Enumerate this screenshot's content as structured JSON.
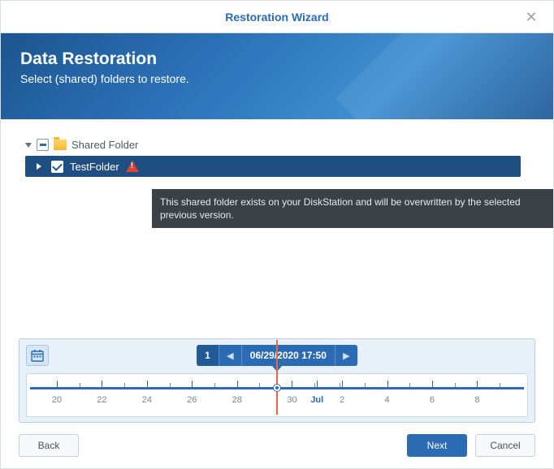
{
  "titlebar": {
    "title": "Restoration Wizard"
  },
  "banner": {
    "title": "Data Restoration",
    "subtitle": "Select (shared) folders to restore."
  },
  "tree": {
    "root_label": "Shared Folder",
    "child_label": "TestFolder"
  },
  "tooltip": {
    "text": "This shared folder exists on your DiskStation and will be overwritten by the selected previous version."
  },
  "timeline": {
    "version_index": "1",
    "current_label": "06/29/2020 17:50",
    "ticks": [
      {
        "label": "20",
        "pct": 6
      },
      {
        "label": "22",
        "pct": 15
      },
      {
        "label": "24",
        "pct": 24
      },
      {
        "label": "26",
        "pct": 33
      },
      {
        "label": "28",
        "pct": 42
      },
      {
        "label": "30",
        "pct": 53
      },
      {
        "label": "Jul",
        "pct": 58,
        "month": true
      },
      {
        "label": "2",
        "pct": 63
      },
      {
        "label": "4",
        "pct": 72
      },
      {
        "label": "6",
        "pct": 81
      },
      {
        "label": "8",
        "pct": 90
      }
    ]
  },
  "footer": {
    "back": "Back",
    "next": "Next",
    "cancel": "Cancel"
  }
}
